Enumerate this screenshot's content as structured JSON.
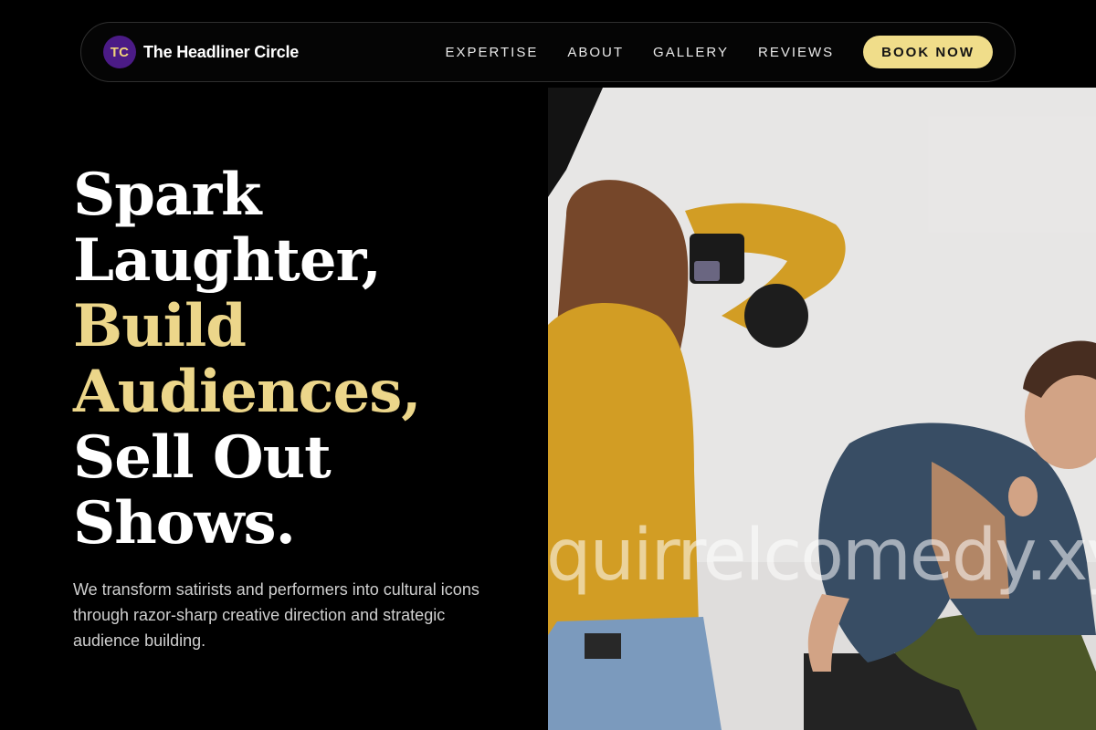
{
  "header": {
    "logo_initials": "TC",
    "brand_name": "The Headliner Circle",
    "nav_items": [
      {
        "label": "EXPERTISE"
      },
      {
        "label": "ABOUT"
      },
      {
        "label": "GALLERY"
      },
      {
        "label": "REVIEWS"
      }
    ],
    "cta_label": "BOOK NOW"
  },
  "hero": {
    "title_lines": [
      {
        "text": "Spark",
        "accent": false
      },
      {
        "text": "Laughter,",
        "accent": false
      },
      {
        "text": "Build",
        "accent": true
      },
      {
        "text": "Audiences,",
        "accent": true
      },
      {
        "text": "Sell Out",
        "accent": false
      },
      {
        "text": "Shows.",
        "accent": false
      }
    ],
    "subtitle": "We transform satirists and performers into cultural icons through razor-sharp creative direction and strategic audience building."
  },
  "media": {
    "watermark_text": "quirrelcomedy.xy"
  },
  "colors": {
    "background": "#000000",
    "accent_gold": "#ECD68A",
    "button_bg": "#F0DD8A",
    "logo_purple": "#4B1B86"
  }
}
